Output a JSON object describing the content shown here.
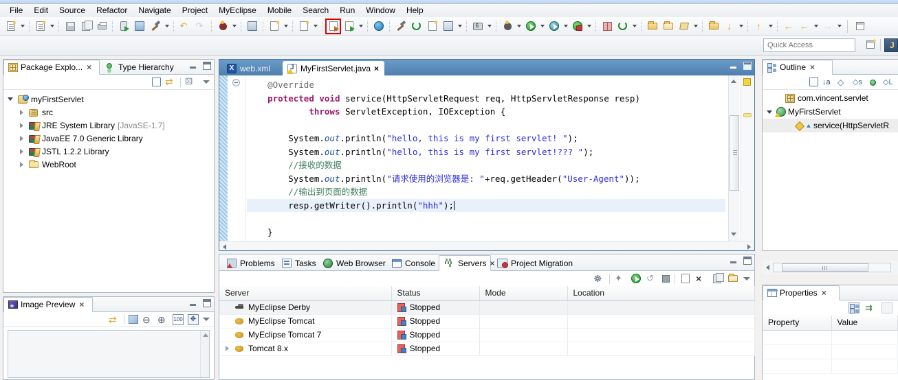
{
  "menubar": {
    "items": [
      "File",
      "Edit",
      "Source",
      "Refactor",
      "Navigate",
      "Project",
      "MyEclipse",
      "Mobile",
      "Search",
      "Run",
      "Window",
      "Help"
    ]
  },
  "toolbar": {
    "highlighted_button": "export-wizard-button",
    "groups": [
      [
        "new-wizard-icon",
        "new-wizard-dropdown",
        "new-file-icon",
        "new-file-dropdown"
      ],
      [
        "save-icon",
        "save-all-icon",
        "print-icon"
      ],
      [
        "deploy-icon",
        "mobile-device-icon",
        "build-hammer-icon",
        "build-dropdown"
      ],
      [
        "undo-icon",
        "redo-icon"
      ],
      [
        "database-explorer-icon",
        "database-dropdown"
      ],
      [
        "webservice-icon",
        "open-type-icon",
        "open-type-dropdown",
        "open-resource-icon",
        "open-resource-dropdown"
      ],
      [
        "export-wizard-icon",
        "server-run-icon",
        "server-dropdown"
      ],
      [
        "open-browser-icon",
        "myeclipse-icon",
        "refresh-icon",
        "report-icon",
        "perspective-icon",
        "perspective-dropdown"
      ],
      [
        "snapshot-icon",
        "snapshot-dropdown",
        "debug-icon",
        "debug-dropdown",
        "run-icon",
        "run-dropdown",
        "run-profile-icon",
        "run-profile-dropdown",
        "run-secure-icon",
        "run-secure-dropdown"
      ],
      [
        "ant-build-icon",
        "refresh-cycle-icon",
        "refresh-cycle-dropdown"
      ],
      [
        "open-folder-icon",
        "close-folder-icon",
        "search-marker-icon",
        "search-dropdown"
      ],
      [
        "prev-annotation-icon",
        "next-annotation-icon",
        "next-dropdown",
        "prev-edit-icon",
        "prev-edit-dropdown",
        "back-icon",
        "back-dropdown",
        "forward-icon",
        "forward-dropdown"
      ],
      [
        "new-perspective-icon"
      ]
    ]
  },
  "quick_access": {
    "placeholder": "Quick Access",
    "value": "",
    "perspective_button": "open-perspective",
    "java_perspective": "Java EE"
  },
  "package_explorer": {
    "tabs": [
      {
        "label": "Package Explo...",
        "icon": "package-explorer-icon",
        "active": true,
        "closable": true
      },
      {
        "label": "Type Hierarchy",
        "icon": "type-hierarchy-icon",
        "active": false,
        "closable": false
      }
    ],
    "toolbar": [
      "collapse-all-icon",
      "link-with-editor-icon",
      "view-menu-icon",
      "view-chevron-icon"
    ],
    "tree": [
      {
        "label": "myFirstServlet",
        "icon": "project-icon",
        "indent": 0,
        "twist": "open",
        "suffix": ""
      },
      {
        "label": "src",
        "icon": "source-folder-icon",
        "indent": 1,
        "twist": "closed",
        "suffix": ""
      },
      {
        "label": "JRE System Library",
        "icon": "library-icon",
        "indent": 1,
        "twist": "closed",
        "suffix": "[JavaSE-1.7]"
      },
      {
        "label": "JavaEE 7.0 Generic Library",
        "icon": "library-icon",
        "indent": 1,
        "twist": "closed",
        "suffix": ""
      },
      {
        "label": "JSTL 1.2.2 Library",
        "icon": "library-icon",
        "indent": 1,
        "twist": "closed",
        "suffix": ""
      },
      {
        "label": "WebRoot",
        "icon": "folder-icon",
        "indent": 1,
        "twist": "closed",
        "suffix": ""
      }
    ]
  },
  "editor": {
    "tabs": [
      {
        "label": "web.xml",
        "icon": "xml-file-icon",
        "active": false,
        "closable": false
      },
      {
        "label": "MyFirstServlet.java",
        "icon": "java-file-warning-icon",
        "active": true,
        "closable": true
      }
    ],
    "code_lines": [
      {
        "highlight": false,
        "tokens": [
          {
            "t": "    ",
            "c": ""
          },
          {
            "t": "@Override",
            "c": "ann"
          }
        ]
      },
      {
        "highlight": false,
        "tokens": [
          {
            "t": "    ",
            "c": ""
          },
          {
            "t": "protected",
            "c": "kw"
          },
          {
            "t": " ",
            "c": ""
          },
          {
            "t": "void",
            "c": "kw"
          },
          {
            "t": " service(HttpServletRequest req, HttpServletResponse resp)",
            "c": ""
          }
        ]
      },
      {
        "highlight": false,
        "tokens": [
          {
            "t": "            ",
            "c": ""
          },
          {
            "t": "throws",
            "c": "kw"
          },
          {
            "t": " ServletException, IOException {",
            "c": ""
          }
        ]
      },
      {
        "highlight": false,
        "tokens": [
          {
            "t": "",
            "c": ""
          }
        ]
      },
      {
        "highlight": false,
        "tokens": [
          {
            "t": "        System.",
            "c": ""
          },
          {
            "t": "out",
            "c": "fld"
          },
          {
            "t": ".println(",
            "c": ""
          },
          {
            "t": "\"hello, this is my first servlet! \"",
            "c": "str"
          },
          {
            "t": ");",
            "c": ""
          }
        ]
      },
      {
        "highlight": false,
        "tokens": [
          {
            "t": "        System.",
            "c": ""
          },
          {
            "t": "out",
            "c": "fld"
          },
          {
            "t": ".println(",
            "c": ""
          },
          {
            "t": "\"hello, this is my first servlet!??? \"",
            "c": "str"
          },
          {
            "t": ");",
            "c": ""
          }
        ]
      },
      {
        "highlight": false,
        "tokens": [
          {
            "t": "        ",
            "c": ""
          },
          {
            "t": "//接收的数据",
            "c": "cmt"
          }
        ]
      },
      {
        "highlight": false,
        "tokens": [
          {
            "t": "        System.",
            "c": ""
          },
          {
            "t": "out",
            "c": "fld"
          },
          {
            "t": ".println(",
            "c": ""
          },
          {
            "t": "\"请求使用的浏览器是: \"",
            "c": "str"
          },
          {
            "t": "+req.getHeader(",
            "c": ""
          },
          {
            "t": "\"User-Agent\"",
            "c": "str"
          },
          {
            "t": "));",
            "c": ""
          }
        ]
      },
      {
        "highlight": false,
        "tokens": [
          {
            "t": "        ",
            "c": ""
          },
          {
            "t": "//输出到页面的数据",
            "c": "cmt"
          }
        ]
      },
      {
        "highlight": true,
        "tokens": [
          {
            "t": "        resp.getWriter().println(",
            "c": ""
          },
          {
            "t": "\"hhh\"",
            "c": "str"
          },
          {
            "t": ");",
            "c": ""
          }
        ]
      },
      {
        "highlight": false,
        "tokens": [
          {
            "t": "",
            "c": ""
          }
        ]
      },
      {
        "highlight": false,
        "tokens": [
          {
            "t": "    }",
            "c": ""
          }
        ]
      }
    ],
    "markers": [
      "warning-marker",
      "occurrence-marker"
    ]
  },
  "bottom_view": {
    "tabs": [
      {
        "label": "Problems",
        "icon": "problems-icon",
        "active": false,
        "closable": false
      },
      {
        "label": "Tasks",
        "icon": "tasks-icon",
        "active": false,
        "closable": false
      },
      {
        "label": "Web Browser",
        "icon": "web-browser-icon",
        "active": false,
        "closable": false
      },
      {
        "label": "Console",
        "icon": "console-icon",
        "active": false,
        "closable": false
      },
      {
        "label": "Servers",
        "icon": "servers-icon",
        "active": true,
        "closable": true
      },
      {
        "label": "Project Migration",
        "icon": "project-migration-icon",
        "active": false,
        "closable": false
      }
    ],
    "toolbar": [
      "link-servers-icon",
      "debug-server-icon",
      "start-server-icon",
      "restart-server-icon",
      "stop-server-icon",
      "publish-icon",
      "remove-server-icon",
      "add-deployment-icon",
      "open-folder-icon",
      "view-chevron-icon"
    ],
    "columns": [
      "Server",
      "Status",
      "Mode",
      "Location"
    ],
    "rows": [
      {
        "server": "MyEclipse Derby",
        "status": "Stopped",
        "mode": "",
        "location": "",
        "icon": "derby-icon",
        "expandable": false,
        "selected": true
      },
      {
        "server": "MyEclipse Tomcat",
        "status": "Stopped",
        "mode": "",
        "location": "",
        "icon": "tomcat-icon",
        "expandable": false,
        "selected": false
      },
      {
        "server": "MyEclipse Tomcat 7",
        "status": "Stopped",
        "mode": "",
        "location": "",
        "icon": "tomcat-icon",
        "expandable": false,
        "selected": false
      },
      {
        "server": "Tomcat  8.x",
        "status": "Stopped",
        "mode": "",
        "location": "",
        "icon": "tomcat-icon",
        "expandable": true,
        "selected": false
      }
    ]
  },
  "image_preview": {
    "tab": {
      "label": "Image Preview",
      "icon": "image-preview-icon",
      "closable": true
    },
    "toolbar": [
      "link-with-editor-icon",
      "image-tool-icon",
      "zoom-out-icon",
      "zoom-in-icon",
      "zoom-100-icon",
      "fit-to-window-icon",
      "view-chevron-icon"
    ]
  },
  "outline": {
    "tab": {
      "label": "Outline",
      "icon": "outline-icon",
      "closable": true
    },
    "toolbar": [
      "collapse-all-icon",
      "sort-alpha-icon",
      "hide-fields-icon",
      "hide-static-icon",
      "hide-nonpublic-icon",
      "hide-local-icon"
    ],
    "items": [
      {
        "label": "com.vincent.servlet",
        "icon": "package-icon",
        "indent": 1,
        "twist": "none",
        "selected": false
      },
      {
        "label": "MyFirstServlet",
        "icon": "class-warning-icon",
        "indent": 0,
        "twist": "open",
        "selected": false
      },
      {
        "label": "service(HttpServletR",
        "icon": "method-icon",
        "indent": 2,
        "twist": "none",
        "selected": true,
        "overlay": "override-arrow"
      }
    ]
  },
  "properties": {
    "tab": {
      "label": "Properties",
      "icon": "properties-icon",
      "closable": true
    },
    "toolbar": [
      "show-categories-icon",
      "show-advanced-icon",
      "restore-defaults-icon"
    ],
    "columns": [
      "Property",
      "Value"
    ],
    "rows": []
  },
  "colors": {
    "accent_blue": "#4f7fae",
    "keyword": "#9d1a6d",
    "string": "#2a2ae0",
    "comment": "#3f7f5f",
    "field": "#1a4fa0",
    "highlight_red": "#e00000"
  }
}
